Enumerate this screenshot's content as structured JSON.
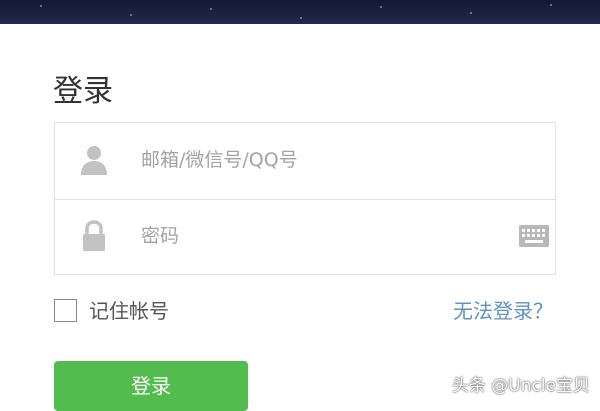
{
  "login": {
    "title": "登录",
    "account_placeholder": "邮箱/微信号/QQ号",
    "password_placeholder": "密码",
    "remember_label": "记住帐号",
    "cannot_login_link": "无法登录？",
    "submit_label": "登录"
  },
  "icons": {
    "account": "user-icon",
    "password": "lock-icon",
    "keyboard": "keyboard-icon"
  },
  "colors": {
    "primary_button": "#53bc4f",
    "link": "#5f92c2",
    "border": "#e1e1e1"
  },
  "watermark": {
    "text": "头条 @Uncle宝贝"
  }
}
